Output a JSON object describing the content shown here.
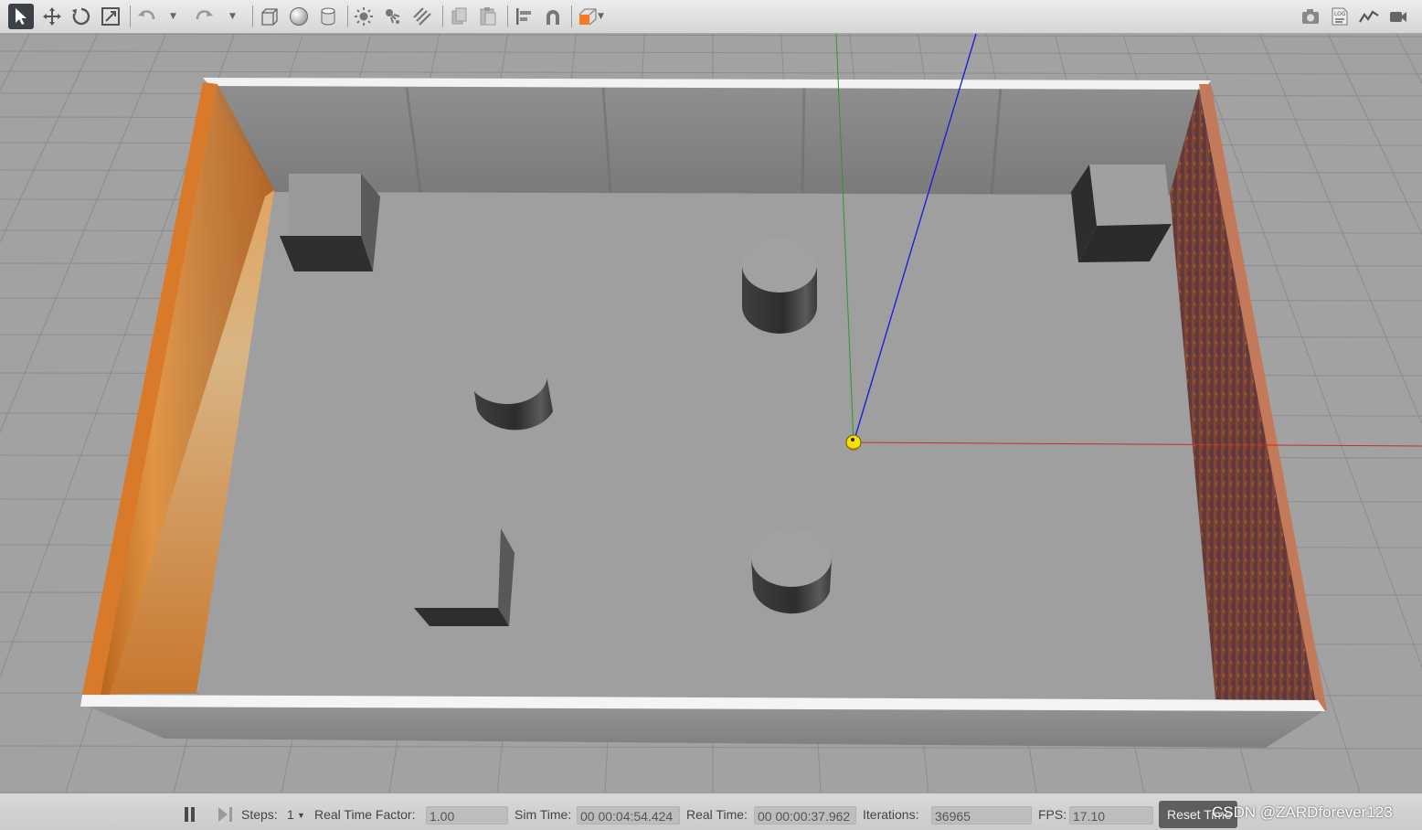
{
  "toolbar": {
    "left_icons": [
      "select-arrow-icon",
      "translate-icon",
      "rotate-icon",
      "scale-icon",
      "undo-icon",
      "redo-icon",
      "box-shape-icon",
      "sphere-shape-icon",
      "cylinder-shape-icon",
      "point-light-icon",
      "spot-light-icon",
      "directional-light-icon",
      "copy-icon",
      "paste-icon",
      "align-icon",
      "snap-magnet-icon",
      "view-angle-icon"
    ],
    "right_icons": [
      "screenshot-camera-icon",
      "log-icon",
      "plot-icon",
      "record-video-icon"
    ],
    "log_icon_label": "LOG",
    "accent_color": "#f47b20"
  },
  "status": {
    "steps_label": "Steps:",
    "steps_value": "1",
    "rtf_label": "Real Time Factor:",
    "rtf_value": "1.00",
    "sim_time_label": "Sim Time:",
    "sim_time_value": "00 00:04:54.424",
    "real_time_label": "Real Time:",
    "real_time_value": "00 00:00:37.962",
    "iterations_label": "Iterations:",
    "iterations_value": "36965",
    "fps_label": "FPS:",
    "fps_value": "17.10",
    "reset_label": "Reset Time"
  },
  "scene": {
    "background_color": "#a2a2a2",
    "grid_color": "#8a8a8a",
    "objects": [
      "north-wall",
      "west-wall-wood",
      "east-wall-brick",
      "south-wall",
      "box-obstacle",
      "box-obstacle",
      "box-obstacle",
      "cylinder-obstacle",
      "cylinder-obstacle",
      "cylinder-obstacle",
      "robot-marker"
    ],
    "axis_colors": {
      "x": "#cc2a2a",
      "y": "#2a9a2a",
      "z": "#1f1fdd"
    },
    "robot_color": "#f5e100"
  },
  "watermark": "CSDN @ZARDforever123"
}
